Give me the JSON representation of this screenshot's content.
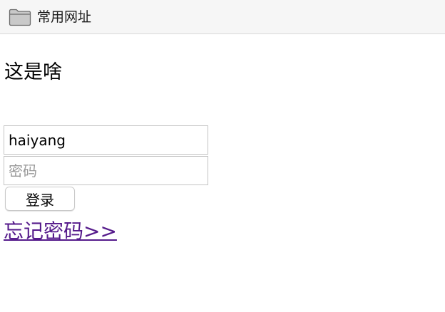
{
  "bookmarks_bar": {
    "folder_icon": "folder-icon",
    "folder_label": "常用网址"
  },
  "page": {
    "heading": "这是啥"
  },
  "login_form": {
    "username_value": "haiyang",
    "password_placeholder": "密码",
    "login_label": "登录",
    "forgot_link_label": "忘记密码>>"
  },
  "colors": {
    "link_visited": "#551a8b",
    "toolbar_bg": "#f6f6f6",
    "input_border": "#c4c4c4"
  }
}
